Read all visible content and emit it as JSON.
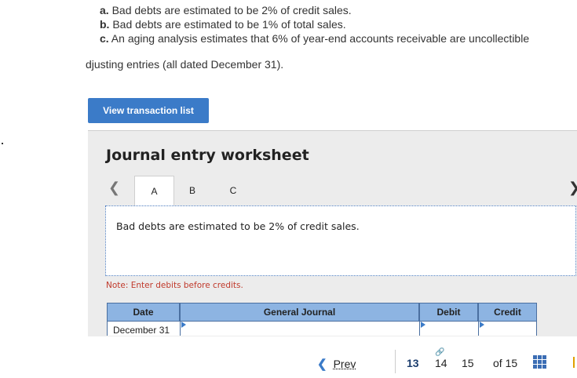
{
  "questions": [
    {
      "prefix": "a.",
      "text": " Bad debts are estimated to be 2% of credit sales."
    },
    {
      "prefix": "b.",
      "text": " Bad debts are estimated to be 1% of total sales."
    },
    {
      "prefix": "c.",
      "text": " An aging analysis estimates that 6% of year-end accounts receivable are uncollectible"
    }
  ],
  "instruction": "djusting entries (all dated December 31).",
  "view_button_label": "View transaction list",
  "worksheet": {
    "title": "Journal entry worksheet",
    "tabs": [
      "A",
      "B",
      "C"
    ],
    "active_tab": "A",
    "description": "Bad debts are estimated to be 2% of credit sales.",
    "note": "Note: Enter debits before credits.",
    "columns": [
      "Date",
      "General Journal",
      "Debit",
      "Credit"
    ],
    "first_row_date": "December 31"
  },
  "footer": {
    "prev_label": "Prev",
    "pages": [
      "13",
      "14",
      "15"
    ],
    "current_page": "13",
    "of_label": "of 15"
  },
  "icons": {
    "prev": "chevron-left-icon",
    "next": "chevron-right-icon",
    "grid": "grid-icon",
    "link": "link-icon"
  },
  "colors": {
    "button": "#3b7bc8",
    "table_header": "#8db4e2",
    "note": "#c0392b"
  }
}
